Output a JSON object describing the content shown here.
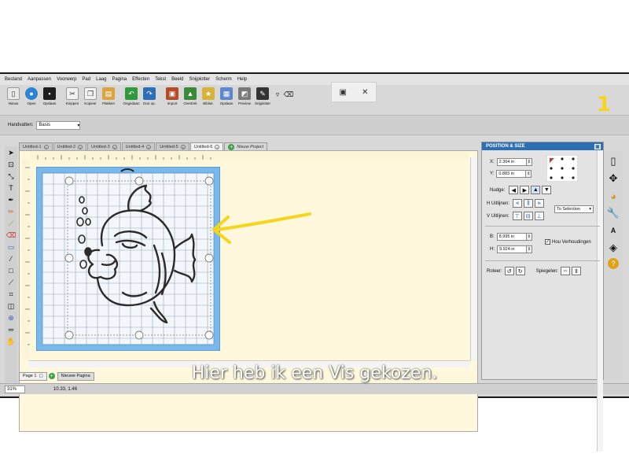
{
  "menu": [
    "Bestand",
    "Aanpassen",
    "Voorwerp",
    "Pad",
    "Laag",
    "Pagina",
    "Effecten",
    "Tekst",
    "Beeld",
    "Snijplotter",
    "Scherm",
    "Help"
  ],
  "toolbar": [
    {
      "label": "Nieuw",
      "icon": "new-doc-icon",
      "color": "#e9e9e9"
    },
    {
      "label": "Open",
      "icon": "open-icon",
      "color": "#2c83d2"
    },
    {
      "label": "Opslaan",
      "icon": "save-icon",
      "color": "#1e1e1e"
    },
    {
      "label": "Knippen",
      "icon": "cut-icon",
      "color": "#f2f2f2"
    },
    {
      "label": "Kopieer",
      "icon": "copy-icon",
      "color": "#f2f2f2"
    },
    {
      "label": "Plakken",
      "icon": "paste-icon",
      "color": "#d9a441"
    },
    {
      "label": "Ongedaan",
      "icon": "undo-icon",
      "color": "#2f9a3b"
    },
    {
      "label": "Doe op.",
      "icon": "redo-icon",
      "color": "#2d6fb6"
    },
    {
      "label": "Import",
      "icon": "import-icon",
      "color": "#b44c2a"
    },
    {
      "label": "Overtrek",
      "icon": "trace-icon",
      "color": "#3a8a3a"
    },
    {
      "label": "Bibliot.",
      "icon": "library-icon",
      "color": "#d9b23a"
    },
    {
      "label": "Opslaan",
      "icon": "store-icon",
      "color": "#5c88c9"
    },
    {
      "label": "Preview",
      "icon": "preview-icon",
      "color": "#7a7a7a"
    },
    {
      "label": "Snijplotter",
      "icon": "cutter-icon",
      "color": "#333333"
    }
  ],
  "step_number": "1",
  "settings": {
    "label": "Handvatten:",
    "value": "Basis"
  },
  "tabs": [
    "Untitled-1",
    "Untitled-2",
    "Untitled-3",
    "Untitled-4",
    "Untitled-5",
    "Untitled-6"
  ],
  "new_project": "Nieuw Project",
  "page": {
    "label": "Page 1",
    "new_page": "Nieuwe Pagina"
  },
  "status": {
    "zoom": "31%",
    "coords": "10.33, 1.46"
  },
  "panel": {
    "title": "POSITION & SIZE",
    "x_label": "X:",
    "x_value": "2.364 in",
    "y_label": "Y:",
    "y_value": "0.883 in",
    "nudge_label": "Nudge:",
    "h_align_label": "H Uitlijnen:",
    "v_align_label": "V Uitlijnen:",
    "align_target": "To Selection",
    "w_label": "B:",
    "w_value": "8.995 in",
    "h_label": "H:",
    "h_value": "9.924 in",
    "keep_ratio_label": "Hou Verhoudingen",
    "rotate_label": "Roteer:",
    "mirror_label": "Spiegelen:"
  },
  "subtitle": "Hier heb ik een Vis gekozen.",
  "colors": {
    "mat": "#78b8ea",
    "canvas": "#fff8dc",
    "panel_head": "#2c6fb5",
    "annotation": "#f7d51d"
  }
}
